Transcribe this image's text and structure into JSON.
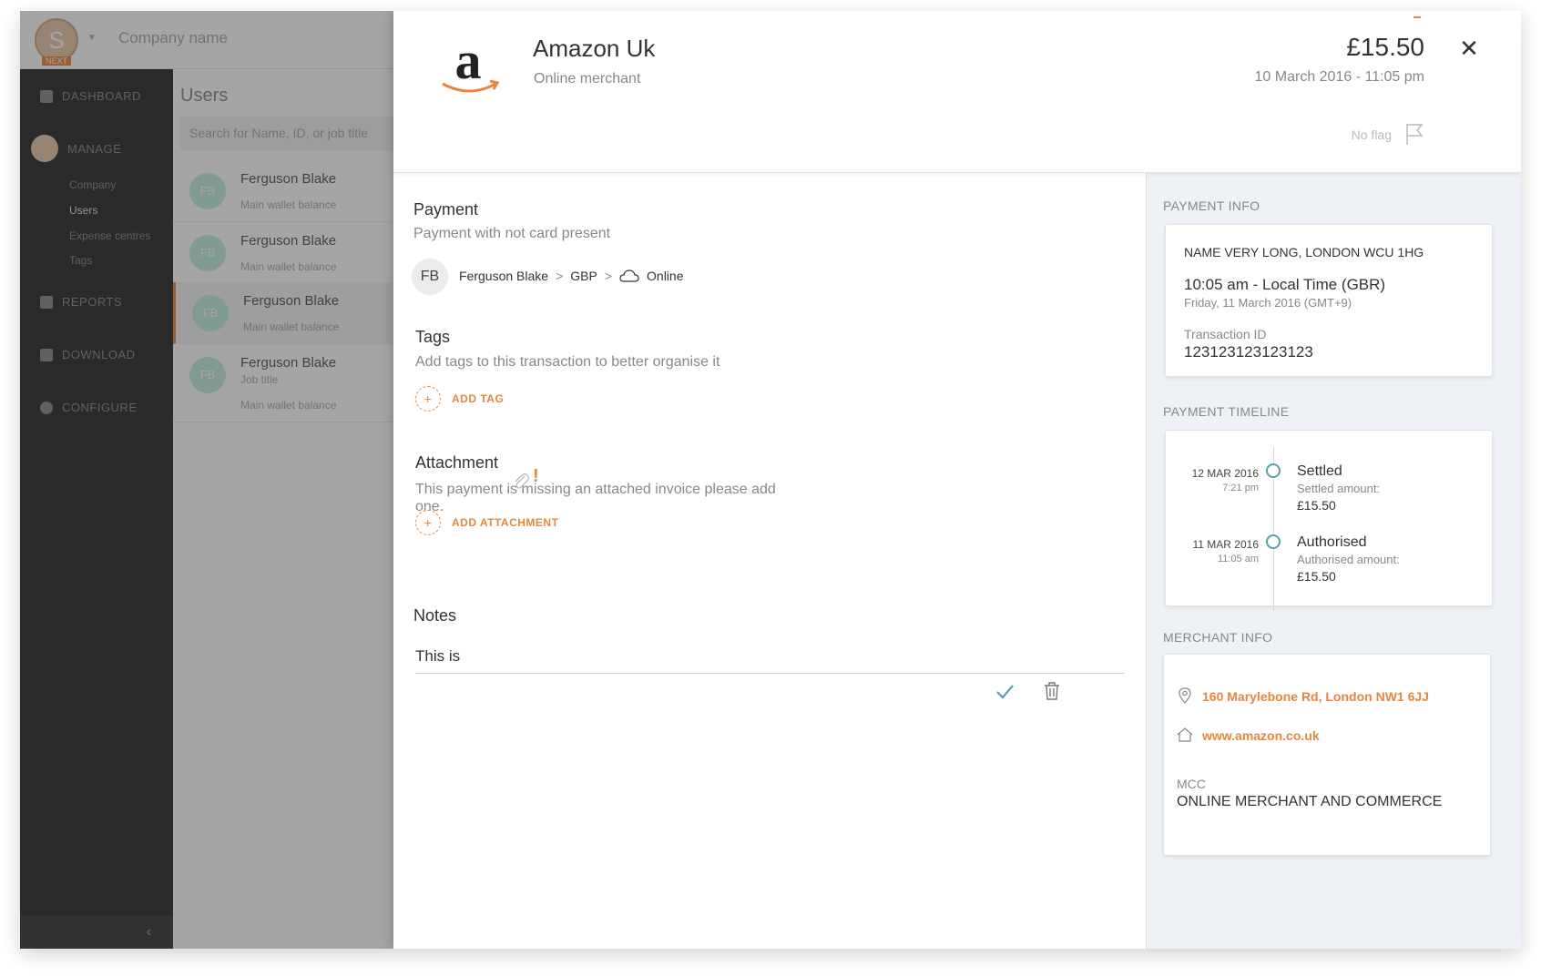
{
  "background": {
    "logo_letter": "S",
    "logo_badge": "NEXT",
    "company_name": "Company name",
    "nav": {
      "dashboard": "DASHBOARD",
      "manage": "MANAGE",
      "sub_company": "Company",
      "sub_users": "Users",
      "sub_expense": "Expense centres",
      "sub_tags": "Tags",
      "reports": "REPORTS",
      "download": "DOWNLOAD",
      "configure": "CONFIGURE"
    },
    "collapse_glyph": "‹",
    "users_title": "Users",
    "search_placeholder": "Search for Name, ID, or job title",
    "users": [
      {
        "initials": "FB",
        "name": "Ferguson Blake",
        "job": "",
        "balance_label": "Main wallet balance"
      },
      {
        "initials": "FB",
        "name": "Ferguson Blake",
        "job": "",
        "balance_label": "Main wallet balance"
      },
      {
        "initials": "FB",
        "name": "Ferguson Blake",
        "job": "",
        "balance_label": "Main wallet balance"
      },
      {
        "initials": "FB",
        "name": "Ferguson Blake",
        "job": "Job title",
        "balance_label": "Main wallet balance"
      }
    ]
  },
  "header": {
    "logo_letter": "a",
    "merchant_name": "Amazon Uk",
    "merchant_type": "Online merchant",
    "amount": "£15.50",
    "date": "10 March 2016  - 11:05 pm",
    "flag_label": "No flag",
    "close_glyph": "✕"
  },
  "payment": {
    "title": "Payment",
    "subtitle": "Payment with not card present",
    "avatar_initials": "FB",
    "crumb_user": "Ferguson Blake",
    "crumb_currency": "GBP",
    "crumb_channel": "Online",
    "crumb_sep": ">"
  },
  "tags": {
    "title": "Tags",
    "subtitle": "Add tags to this transaction to better organise it",
    "add_label": "ADD TAG"
  },
  "attachment": {
    "title": "Attachment",
    "warning": "!",
    "subtitle": "This payment is missing an attached invoice please add one.",
    "add_label": "ADD ATTACHMENT"
  },
  "notes": {
    "title": "Notes",
    "value": "This is"
  },
  "payment_info": {
    "label": "PAYMENT INFO",
    "name": "NAME VERY LONG, LONDON WCU 1HG",
    "local_time": "10:05 am - Local Time (GBR)",
    "date_line": "Friday, 11 March 2016 (GMT+9)",
    "txn_label": "Transaction ID",
    "txn_id": "123123123123123"
  },
  "timeline": {
    "label": "PAYMENT TIMELINE",
    "events": [
      {
        "date": "12 MAR 2016",
        "time": "7:21 pm",
        "status": "Settled",
        "amount_label": "Settled amount:",
        "amount": "£15.50"
      },
      {
        "date": "11 MAR 2016",
        "time": "11:05 am",
        "status": "Authorised",
        "amount_label": "Authorised amount:",
        "amount": "£15.50"
      }
    ]
  },
  "merchant_info": {
    "label": "MERCHANT INFO",
    "address": "160 Marylebone Rd, London NW1 6JJ",
    "website": "www.amazon.co.uk",
    "mcc_label": "MCC",
    "mcc_value": "ONLINE MERCHANT AND COMMERCE"
  },
  "colors": {
    "accent": "#e8863f",
    "timeline_dot": "#5b9fa8",
    "side_bg": "#eef1f5"
  }
}
